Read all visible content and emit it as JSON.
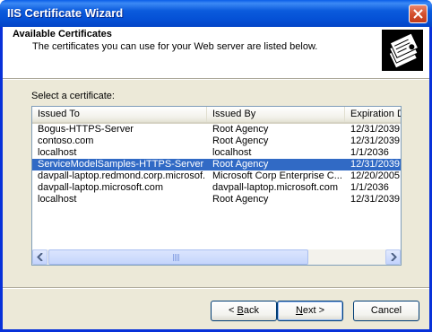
{
  "window": {
    "title": "IIS Certificate Wizard"
  },
  "header": {
    "title": "Available Certificates",
    "subtitle": "The certificates you can use for your Web server are listed below."
  },
  "select_label": "Select a certificate:",
  "list": {
    "columns": [
      "Issued To",
      "Issued By",
      "Expiration D"
    ],
    "rows": [
      {
        "issued_to": "Bogus-HTTPS-Server",
        "issued_by": "Root Agency",
        "expiration": "12/31/2039",
        "selected": false
      },
      {
        "issued_to": "contoso.com",
        "issued_by": "Root Agency",
        "expiration": "12/31/2039",
        "selected": false
      },
      {
        "issued_to": "localhost",
        "issued_by": "localhost",
        "expiration": "1/1/2036",
        "selected": false
      },
      {
        "issued_to": "ServiceModelSamples-HTTPS-Server",
        "issued_by": "Root Agency",
        "expiration": "12/31/2039",
        "selected": true
      },
      {
        "issued_to": "davpall-laptop.redmond.corp.microsof...",
        "issued_by": "Microsoft Corp Enterprise C...",
        "expiration": "12/20/2005",
        "selected": false
      },
      {
        "issued_to": "davpall-laptop.microsoft.com",
        "issued_by": "davpall-laptop.microsoft.com",
        "expiration": "1/1/2036",
        "selected": false
      },
      {
        "issued_to": "localhost",
        "issued_by": "Root Agency",
        "expiration": "12/31/2039",
        "selected": false
      }
    ]
  },
  "buttons": {
    "back": {
      "label": "< Back",
      "mnemonic": "B"
    },
    "next": {
      "label": "Next >",
      "mnemonic": "N"
    },
    "cancel": {
      "label": "Cancel"
    }
  },
  "colors": {
    "title_bar": "#0551d6",
    "selection": "#316ac5",
    "dialog_bg": "#ece9d8"
  },
  "icons": [
    "close-icon",
    "certificate-wizard-icon",
    "scroll-left-icon",
    "scroll-right-icon"
  ]
}
